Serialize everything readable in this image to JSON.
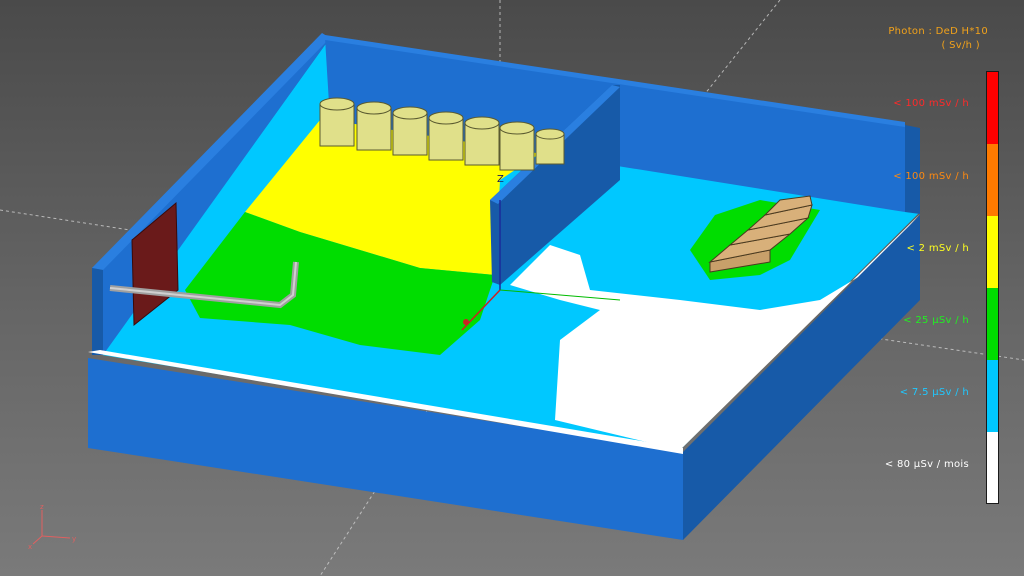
{
  "legend": {
    "title_line1": "Photon : DeD H*10",
    "title_line2": "( Sv/h )",
    "bands": [
      {
        "label": "< 100 mSv / h",
        "color": "#ff0000",
        "label_color": "#ff2a2a"
      },
      {
        "label": "< 100 mSv / h",
        "color": "#ff7a00",
        "label_color": "#ff8a10"
      },
      {
        "label": "< 2   mSv / h",
        "color": "#ffff00",
        "label_color": "#ffff20"
      },
      {
        "label": "< 25  µSv / h",
        "color": "#00dd00",
        "label_color": "#22ee22"
      },
      {
        "label": "< 7.5 µSv / h",
        "color": "#00c8ff",
        "label_color": "#20c8ff"
      },
      {
        "label": "< 80  µSv / mois",
        "color": "#ffffff",
        "label_color": "#ffffff"
      }
    ]
  },
  "scene": {
    "colors": {
      "wall": "#1e6fd0",
      "wall_dark": "#175aa8",
      "wall_side": "#1a62bb",
      "door": "#6a1a1a",
      "tank": "#e0e08a",
      "box": "#c8a06a"
    },
    "z_axis_label": "Z",
    "triad": {
      "z": "z",
      "x": "x",
      "y": "y"
    }
  }
}
